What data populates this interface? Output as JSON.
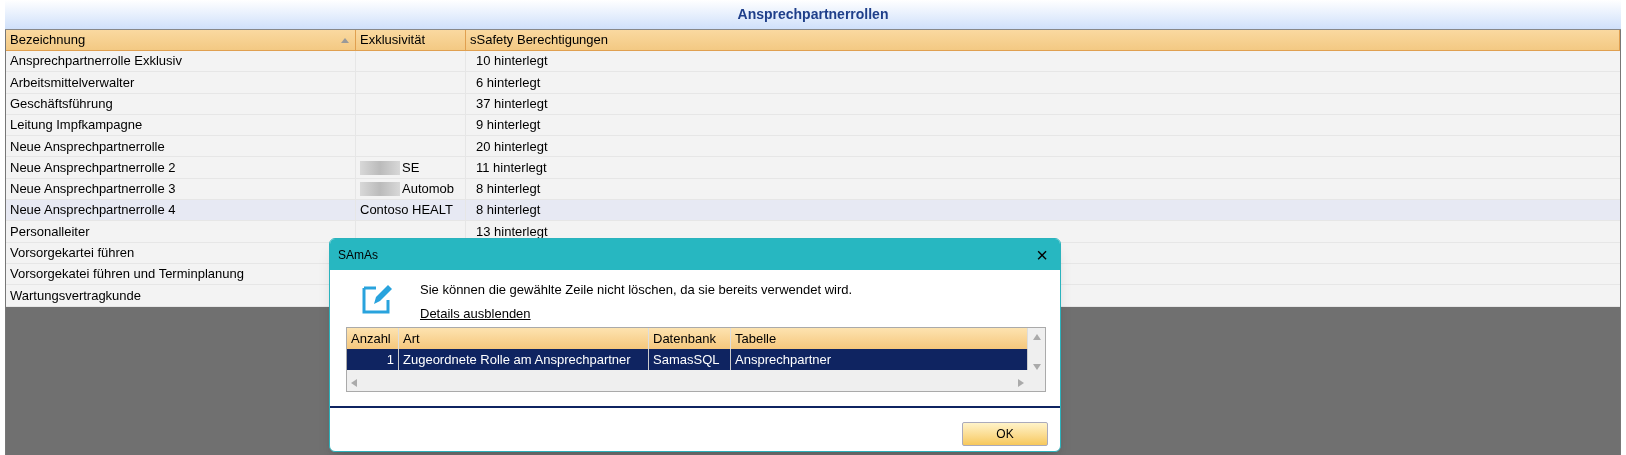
{
  "title": "Ansprechpartnerrollen",
  "table": {
    "columns": [
      {
        "label": "Bezeichnung",
        "sorted": true
      },
      {
        "label": "Exklusivität",
        "sorted": false
      },
      {
        "label": "sSafety Berechtigungen",
        "sorted": false
      }
    ],
    "rows": [
      {
        "name": "Ansprechpartnerrolle Exklusiv",
        "exclusivity": "",
        "redacted": false,
        "permissions": "10 hinterlegt",
        "selected": false
      },
      {
        "name": "Arbeitsmittelverwalter",
        "exclusivity": "",
        "redacted": false,
        "permissions": "6 hinterlegt",
        "selected": false
      },
      {
        "name": "Geschäftsführung",
        "exclusivity": "",
        "redacted": false,
        "permissions": "37 hinterlegt",
        "selected": false
      },
      {
        "name": "Leitung Impfkampagne",
        "exclusivity": "",
        "redacted": false,
        "permissions": "9 hinterlegt",
        "selected": false
      },
      {
        "name": "Neue Ansprechpartnerrolle",
        "exclusivity": "",
        "redacted": false,
        "permissions": "20 hinterlegt",
        "selected": false
      },
      {
        "name": "Neue Ansprechpartnerrolle 2",
        "exclusivity": "SE",
        "redacted": true,
        "permissions": "11 hinterlegt",
        "selected": false
      },
      {
        "name": "Neue Ansprechpartnerrolle 3",
        "exclusivity": "Automob",
        "redacted": true,
        "permissions": "8 hinterlegt",
        "selected": false
      },
      {
        "name": "Neue Ansprechpartnerrolle 4",
        "exclusivity": "Contoso HEALT",
        "redacted": false,
        "permissions": "8 hinterlegt",
        "selected": true
      },
      {
        "name": "Personalleiter",
        "exclusivity": "",
        "redacted": false,
        "permissions": "13 hinterlegt",
        "selected": false
      },
      {
        "name": "Vorsorgekartei führen",
        "exclusivity": "",
        "redacted": false,
        "permissions": "",
        "selected": false
      },
      {
        "name": "Vorsorgekatei führen und Terminplanung",
        "exclusivity": "",
        "redacted": false,
        "permissions": "",
        "selected": false
      },
      {
        "name": "Wartungsvertragkunde",
        "exclusivity": "",
        "redacted": false,
        "permissions": "",
        "selected": false
      }
    ]
  },
  "dialog": {
    "title": "SAmAs",
    "close": "×",
    "message": "Sie können die gewählte Zeile nicht löschen, da sie bereits verwendet wird.",
    "details_link": "Details ausblenden",
    "grid": {
      "columns": [
        "Anzahl",
        "Art",
        "Datenbank",
        "Tabelle"
      ],
      "rows": [
        {
          "cells": [
            "1",
            "Zugeordnete Rolle am Ansprechpartner",
            "SamasSQL",
            "Ansprechpartner"
          ],
          "selected": true
        }
      ]
    },
    "ok_button": "OK"
  }
}
